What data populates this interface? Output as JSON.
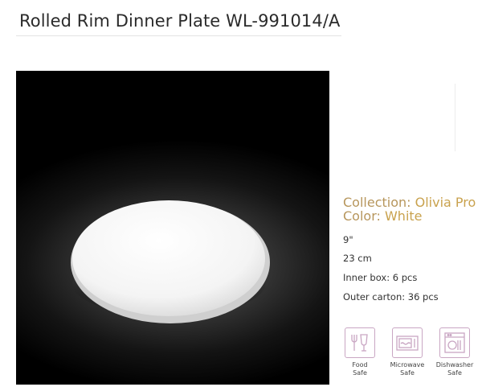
{
  "product": {
    "title": "Rolled Rim Dinner Plate WL-991014/A"
  },
  "specs": {
    "collection_label": "Collection:",
    "collection_value": "Olivia Pro",
    "color_label": "Color:",
    "color_value": "White",
    "size_in": "9\"",
    "size_cm": "23 cm",
    "inner_box": "Inner box: 6 pcs",
    "outer_carton": "Outer carton: 36 pcs"
  },
  "features": [
    {
      "line1": "Food",
      "line2": "Safe",
      "icon": "food-safe-icon"
    },
    {
      "line1": "Microwave",
      "line2": "Safe",
      "icon": "microwave-safe-icon"
    },
    {
      "line1": "Dishwasher",
      "line2": "Safe",
      "icon": "dishwasher-safe-icon"
    }
  ],
  "colors": {
    "accent_gold": "#c9a24e",
    "icon_purple": "#c9a6c3"
  }
}
